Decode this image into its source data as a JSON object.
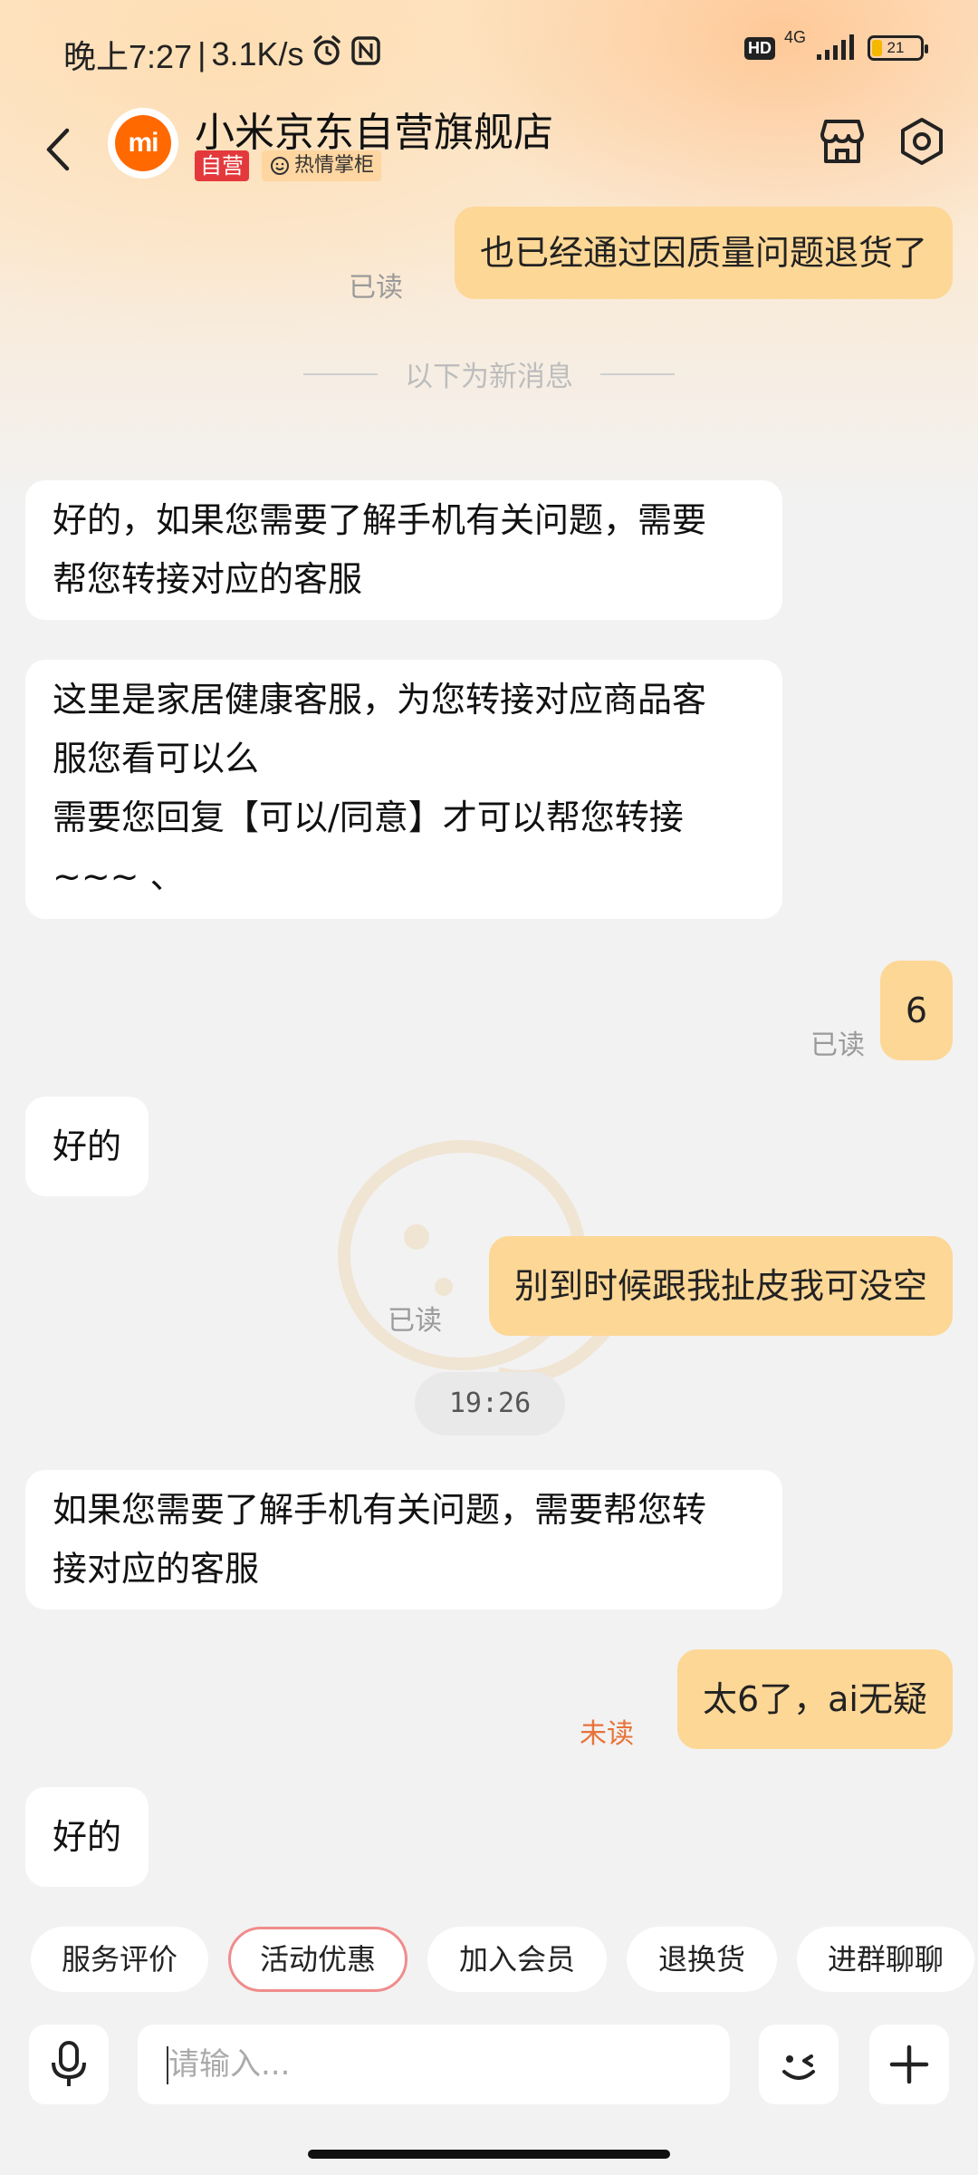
{
  "status_bar": {
    "time": "晚上7:27",
    "separator": "|",
    "speed": "3.1K/s",
    "hd": "HD",
    "network": "4G",
    "battery": "21",
    "battery_fraction": 0.21,
    "battery_color": "#f5b800"
  },
  "header": {
    "store_logo": "mi",
    "store_name": "小米京东自营旗舰店",
    "tag_self": "自营",
    "tag_locker": "热情掌柜"
  },
  "messages": {
    "m1": {
      "text": "也已经通过因质量问题退货了",
      "status": "已读"
    },
    "divider": "以下为新消息",
    "m2": {
      "line1": "好的，如果您需要了解手机有关问题，需要",
      "line2": "帮您转接对应的客服"
    },
    "m3": {
      "line1": "这里是家居健康客服，为您转接对应商品客",
      "line2": "服您看可以么",
      "line3": "需要您回复【可以/同意】才可以帮您转接",
      "line4": "~~~ 、"
    },
    "m4": {
      "text": "6",
      "status": "已读"
    },
    "m5": {
      "text": "好的"
    },
    "m6": {
      "text": "别到时候跟我扯皮我可没空",
      "status": "已读"
    },
    "time": "19:26",
    "m7": {
      "line1": "如果您需要了解手机有关问题，需要帮您转",
      "line2": "接对应的客服"
    },
    "m8": {
      "text": "太6了，ai无疑",
      "status": "未读"
    },
    "m9": {
      "text": "好的"
    }
  },
  "quick_replies": [
    "服务评价",
    "活动优惠",
    "加入会员",
    "退换货",
    "进群聊聊"
  ],
  "input": {
    "placeholder": "请输入..."
  },
  "colors": {
    "accent": "#ff6900",
    "outgoing_bubble": "#fdd796",
    "unread": "#e8733a",
    "self_tag": "#e4393c"
  }
}
